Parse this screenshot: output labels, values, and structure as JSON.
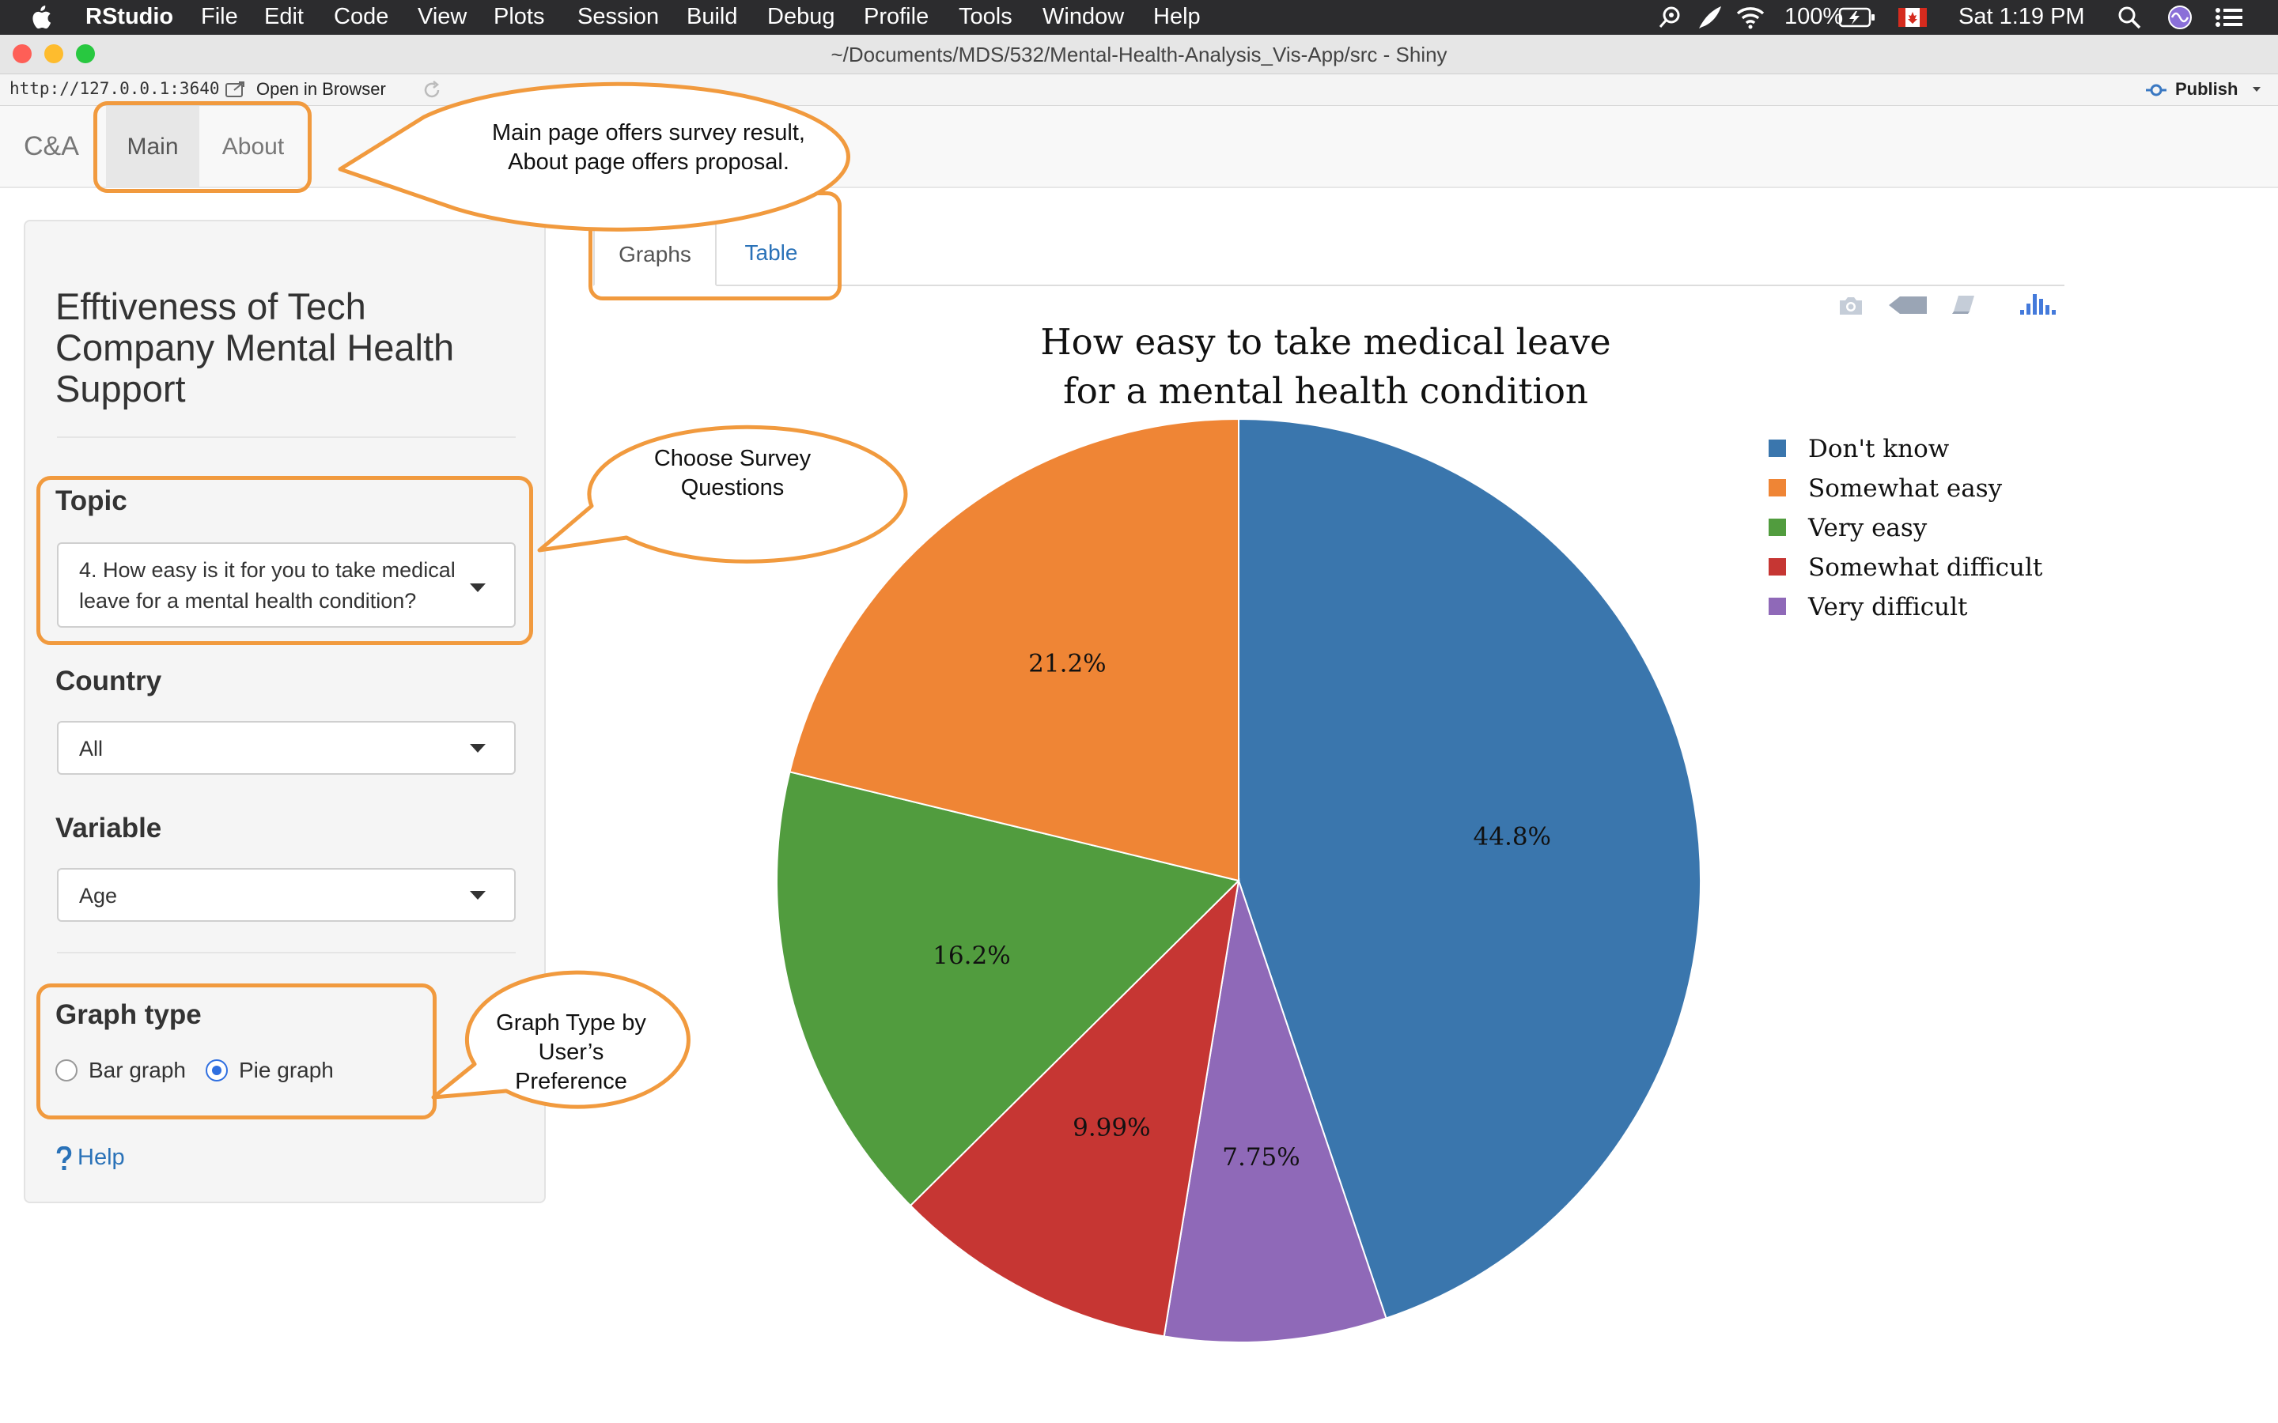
{
  "menubar": {
    "app": "RStudio",
    "items": [
      "File",
      "Edit",
      "Code",
      "View",
      "Plots",
      "Session",
      "Build",
      "Debug",
      "Profile",
      "Tools",
      "Window",
      "Help"
    ],
    "battery": "100%",
    "clock": "Sat 1:19 PM"
  },
  "window": {
    "title": "~/Documents/MDS/532/Mental-Health-Analysis_Vis-App/src - Shiny"
  },
  "viewer": {
    "url": "http://127.0.0.1:3640",
    "open_in_browser": "Open in Browser",
    "publish": "Publish"
  },
  "navbar": {
    "brand": "C&A",
    "tabs": [
      {
        "label": "Main",
        "active": true
      },
      {
        "label": "About",
        "active": false
      }
    ]
  },
  "sidebar": {
    "title": "Efftiveness of Tech Company Mental Health Support",
    "topic_label": "Topic",
    "topic_value": "4. How easy is it for you to take medical leave for a mental health condition?",
    "country_label": "Country",
    "country_value": "All",
    "variable_label": "Variable",
    "variable_value": "Age",
    "graph_type_label": "Graph type",
    "graph_options": [
      {
        "label": "Bar graph",
        "selected": false
      },
      {
        "label": "Pie graph",
        "selected": true
      }
    ],
    "help": "Help"
  },
  "output_tabs": [
    {
      "label": "Graphs",
      "active": true
    },
    {
      "label": "Table",
      "active": false
    }
  ],
  "modebar_icons": [
    "camera-icon",
    "tag-icon",
    "book-icon",
    "plotly-logo-icon"
  ],
  "annotations": {
    "nav_note": [
      "Main page offers survey result,",
      "About page offers proposal."
    ],
    "topic_note": [
      "Choose Survey",
      "Questions"
    ],
    "graph_note": [
      "Graph Type by",
      "User’s",
      "Preference"
    ],
    "accent_color": "#f19a3e"
  },
  "chart_data": {
    "type": "pie",
    "title": [
      "How easy to take medical leave",
      "for a mental health condition"
    ],
    "slices": [
      {
        "name": "Don't know",
        "value": 44.8,
        "label": "44.8%",
        "color": "#3a76ad"
      },
      {
        "name": "Very difficult",
        "value": 7.75,
        "label": "7.75%",
        "color": "#8f69b8"
      },
      {
        "name": "Somewhat difficult",
        "value": 9.99,
        "label": "9.99%",
        "color": "#c63633"
      },
      {
        "name": "Very easy",
        "value": 16.2,
        "label": "16.2%",
        "color": "#519c3e"
      },
      {
        "name": "Somewhat easy",
        "value": 21.2,
        "label": "21.2%",
        "color": "#ef8535"
      }
    ],
    "legend": [
      "Don't know",
      "Somewhat easy",
      "Very easy",
      "Somewhat difficult",
      "Very difficult"
    ],
    "legend_placement": "top-right",
    "direction": "clockwise",
    "start": "top"
  }
}
